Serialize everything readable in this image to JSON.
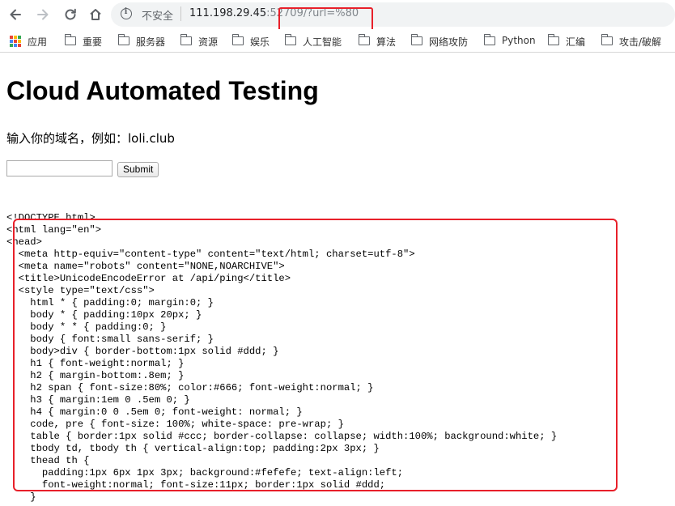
{
  "browser": {
    "security_label": "不安全",
    "url_host": "111.198.29.45",
    "url_rest": ":52709/?url=%80",
    "highlight_color": "#e8202a"
  },
  "bookmarks": [
    {
      "label": "应用",
      "icon": "apps-icon"
    },
    {
      "label": "重要",
      "icon": "folder-icon"
    },
    {
      "label": "服务器",
      "icon": "folder-icon"
    },
    {
      "label": "资源",
      "icon": "folder-icon"
    },
    {
      "label": "娱乐",
      "icon": "folder-icon"
    },
    {
      "label": "人工智能",
      "icon": "folder-icon"
    },
    {
      "label": "算法",
      "icon": "folder-icon"
    },
    {
      "label": "网络攻防",
      "icon": "folder-icon"
    },
    {
      "label": "Python",
      "icon": "folder-icon"
    },
    {
      "label": "汇编",
      "icon": "folder-icon"
    },
    {
      "label": "攻击/破解",
      "icon": "folder-icon"
    }
  ],
  "page": {
    "title": "Cloud Automated Testing",
    "prompt": "输入你的域名，例如：loli.club",
    "input_value": "",
    "submit_label": "Submit"
  },
  "response_source": "<!DOCTYPE html>\n<html lang=\"en\">\n<head>\n  <meta http-equiv=\"content-type\" content=\"text/html; charset=utf-8\">\n  <meta name=\"robots\" content=\"NONE,NOARCHIVE\">\n  <title>UnicodeEncodeError at /api/ping</title>\n  <style type=\"text/css\">\n    html * { padding:0; margin:0; }\n    body * { padding:10px 20px; }\n    body * * { padding:0; }\n    body { font:small sans-serif; }\n    body>div { border-bottom:1px solid #ddd; }\n    h1 { font-weight:normal; }\n    h2 { margin-bottom:.8em; }\n    h2 span { font-size:80%; color:#666; font-weight:normal; }\n    h3 { margin:1em 0 .5em 0; }\n    h4 { margin:0 0 .5em 0; font-weight: normal; }\n    code, pre { font-size: 100%; white-space: pre-wrap; }\n    table { border:1px solid #ccc; border-collapse: collapse; width:100%; background:white; }\n    tbody td, tbody th { vertical-align:top; padding:2px 3px; }\n    thead th {\n      padding:1px 6px 1px 3px; background:#fefefe; text-align:left;\n      font-weight:normal; font-size:11px; border:1px solid #ddd;\n    }"
}
